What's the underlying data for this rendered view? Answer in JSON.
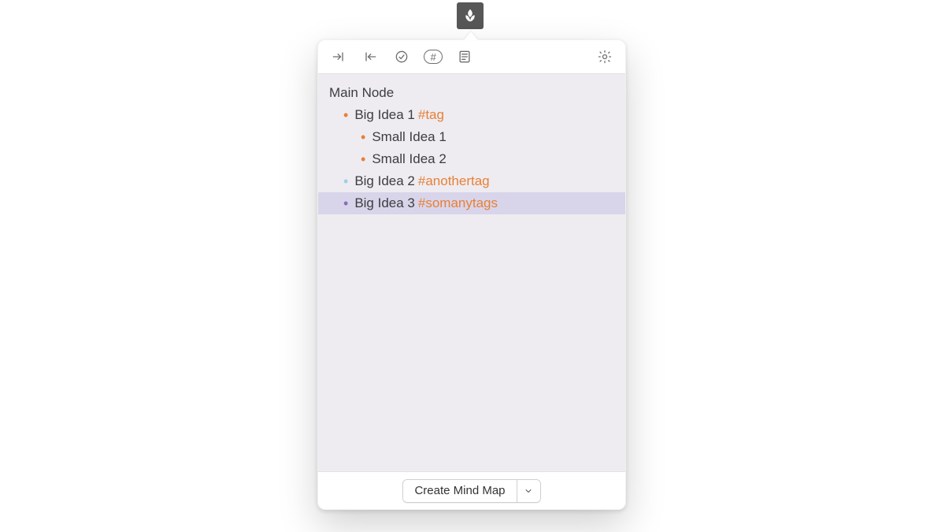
{
  "app": {
    "icon_name": "leaf-icon"
  },
  "toolbar": {
    "indent_label": "indent",
    "outdent_label": "outdent",
    "check_label": "toggle-check",
    "hash_label": "#",
    "note_label": "note",
    "settings_label": "settings"
  },
  "outline": {
    "root": {
      "text": "Main Node"
    },
    "items": [
      {
        "text": "Big Idea 1",
        "tag": "#tag",
        "bullet_color": "#e88036",
        "indent": 1,
        "selected": false
      },
      {
        "text": "Small Idea 1",
        "tag": "",
        "bullet_color": "#e88036",
        "indent": 2,
        "selected": false
      },
      {
        "text": "Small Idea 2",
        "tag": "",
        "bullet_color": "#e88036",
        "indent": 2,
        "selected": false
      },
      {
        "text": "Big Idea 2",
        "tag": "#anothertag",
        "bullet_color": "#a0cfe8",
        "indent": 1,
        "selected": false
      },
      {
        "text": "Big Idea 3",
        "tag": "#somanytags",
        "bullet_color": "#8a6fb8",
        "indent": 1,
        "selected": true
      }
    ]
  },
  "footer": {
    "create_label": "Create Mind Map"
  },
  "colors": {
    "tag": "#e88036",
    "panel_bg": "#eeecf1",
    "selected_row": "#d8d5ea"
  }
}
